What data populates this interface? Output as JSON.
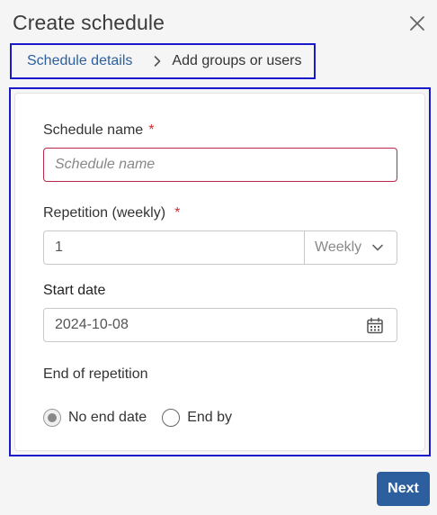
{
  "dialog": {
    "title": "Create schedule",
    "close_icon": "close-icon"
  },
  "breadcrumb": {
    "steps": [
      {
        "label": "Schedule details",
        "active": true
      },
      {
        "label": "Add groups or users",
        "active": false
      }
    ],
    "separator_icon": "chevron-right-icon"
  },
  "form": {
    "schedule_name": {
      "label": "Schedule name",
      "required_mark": "*",
      "value": "",
      "placeholder": "Schedule name"
    },
    "repetition": {
      "label": "Repetition (weekly)",
      "required_mark": "*",
      "value": "1",
      "unit_selected": "Weekly",
      "unit_icon": "chevron-down-icon"
    },
    "start_date": {
      "label": "Start date",
      "value": "2024-10-08",
      "icon": "calendar-icon"
    },
    "end_of_repetition": {
      "label": "End of repetition",
      "options": [
        {
          "label": "No end date",
          "checked": true
        },
        {
          "label": "End by",
          "checked": false
        }
      ]
    }
  },
  "footer": {
    "next_label": "Next"
  },
  "colors": {
    "accent": "#2d5f9e",
    "required": "#d32f2f",
    "error_border": "#b8284a",
    "highlight_outline": "#1a1acc"
  }
}
